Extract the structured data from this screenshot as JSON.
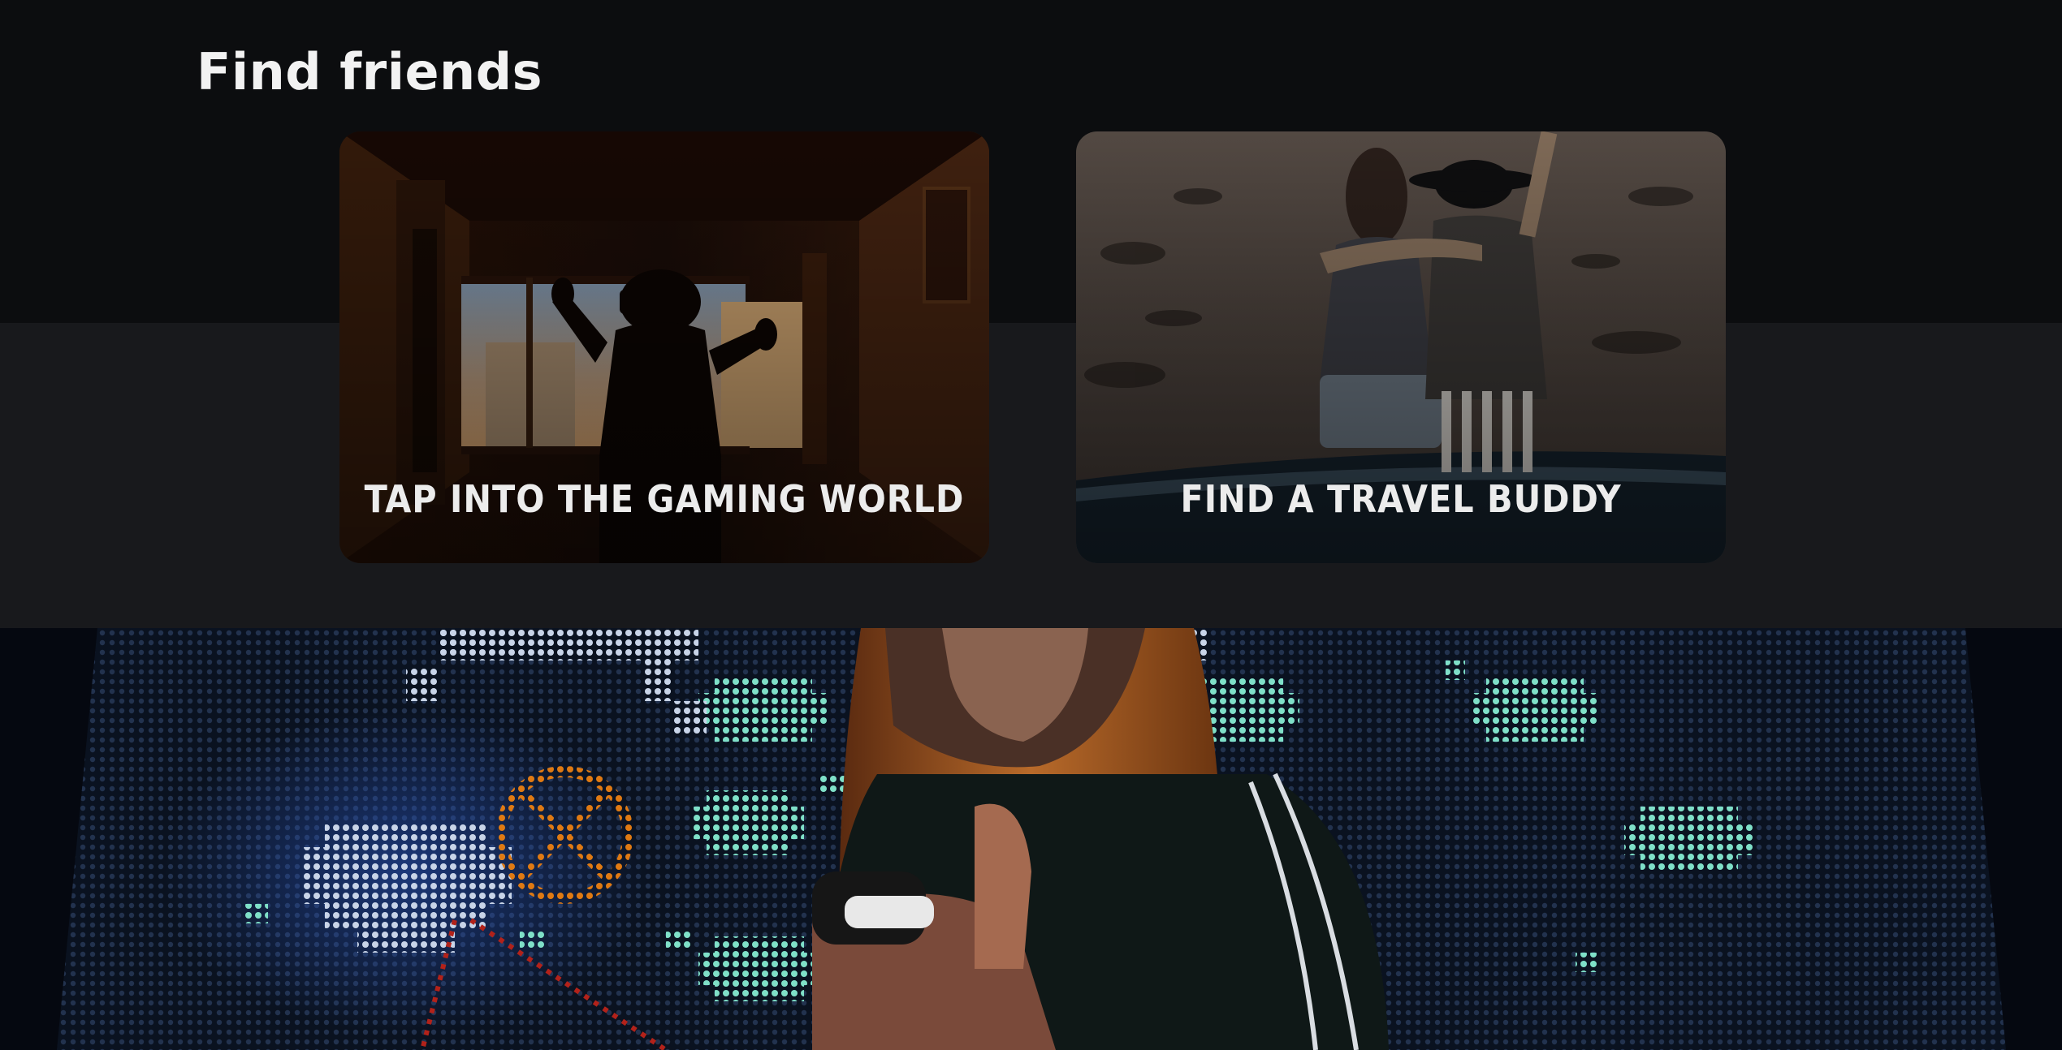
{
  "section": {
    "title": "Find friends"
  },
  "cards": [
    {
      "label": "TAP INTO THE GAMING WORLD"
    },
    {
      "label": "FIND A TRAVEL BUDDY"
    }
  ],
  "colors": {
    "page_top": "#0c0d0f",
    "band": "#18191c",
    "title": "#f2f2f2",
    "card_label": "#ececec",
    "arcade_teal": "#7fe0c8",
    "arcade_orange": "#e07a12"
  }
}
